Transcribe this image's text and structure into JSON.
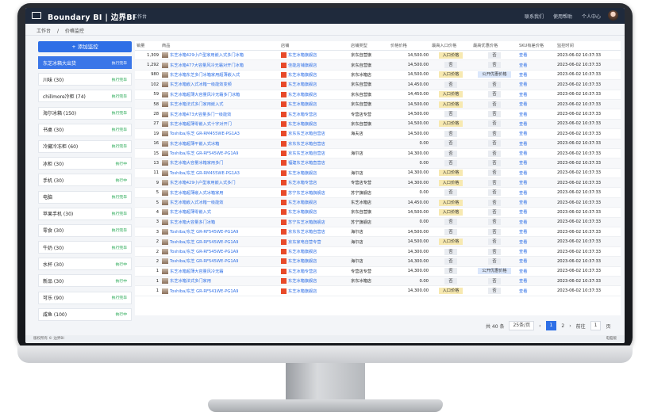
{
  "app": {
    "brand": "Boundary BI | 边界BI",
    "nav": "工作台",
    "right_items": [
      "联系我们",
      "使用帮助",
      "个人中心"
    ]
  },
  "breadcrumb": [
    "工作台",
    "价格监控"
  ],
  "sidebar": {
    "add_label": "+ 添加监控",
    "items": [
      {
        "label": "东芝冰箱大出货",
        "badge": "执行完毕",
        "active": true
      },
      {
        "label": "川味 (30)",
        "badge": "执行完毕"
      },
      {
        "label": "chillmore冷柜 (74)",
        "badge": "执行完毕"
      },
      {
        "label": "海尔冰箱 (150)",
        "badge": "执行完毕"
      },
      {
        "label": "书桌 (30)",
        "badge": "执行完毕"
      },
      {
        "label": "冷藏冷冻柜 (60)",
        "badge": "执行完毕"
      },
      {
        "label": "冰柜 (30)",
        "badge": "执行中"
      },
      {
        "label": "手机 (30)",
        "badge": "执行中"
      },
      {
        "label": "电脑",
        "badge": "执行完毕"
      },
      {
        "label": "苹果手机 (30)",
        "badge": "执行完毕"
      },
      {
        "label": "零食 (30)",
        "badge": "执行完毕"
      },
      {
        "label": "牛奶 (30)",
        "badge": "执行完毕"
      },
      {
        "label": "水杯 (30)",
        "badge": "执行中"
      },
      {
        "label": "新品 (30)",
        "badge": "执行中"
      },
      {
        "label": "可乐 (90)",
        "badge": "执行完毕"
      },
      {
        "label": "咸鱼 (100)",
        "badge": "执行中"
      }
    ]
  },
  "table": {
    "headers": [
      "销量",
      "商品",
      "店铺",
      "店铺类型",
      "价格价格",
      "最高入口价格",
      "最高优惠价格",
      "SKU有差价格",
      "监控时间"
    ],
    "rows": [
      [
        "1,309",
        "东芝冰箱429小户型家用嵌入式多门冰箱",
        "东芝冰箱旗舰店",
        "京东自营旗",
        "14,500.00",
        "入口价格",
        "否",
        "查看",
        "2023-06-02 10:37:33"
      ],
      [
        "1,292",
        "东芝冰箱477大容量风冷无霜对开门冰箱",
        "佳能店铺旗舰店",
        "京东自营旗",
        "14,500.00",
        "否",
        "否",
        "查看",
        "2023-06-02 10:37:33"
      ],
      [
        "980",
        "东芝冰箱东芝多门冰箱家用超薄嵌入式",
        "东芝冰箱旗舰店",
        "京东冰箱店",
        "14,500.00",
        "入口价格",
        "公开优惠价格",
        "查看",
        "2023-06-02 10:37:33"
      ],
      [
        "102",
        "东芝冰箱嵌入式冰箱一级能效变频",
        "东芝冰箱旗舰店",
        "京东自营旗",
        "14,450.00",
        "否",
        "否",
        "查看",
        "2023-06-02 10:37:33"
      ],
      [
        "59",
        "东芝冰箱超薄大容量风冷无霜多门冰箱",
        "东芝冰箱旗舰店",
        "京东自营旗",
        "14,450.00",
        "入口价格",
        "否",
        "查看",
        "2023-06-02 10:37:33"
      ],
      [
        "58",
        "东芝冰箱法式多门家用嵌入式",
        "东芝冰箱旗舰店",
        "京东自营旗",
        "14,500.00",
        "入口价格",
        "否",
        "查看",
        "2023-06-02 10:37:33"
      ],
      [
        "28",
        "东芝冰箱473大容量多门一级能效",
        "东芝冰箱专营店",
        "专营店专营",
        "14,500.00",
        "否",
        "否",
        "查看",
        "2023-06-02 10:37:33"
      ],
      [
        "27",
        "东芝冰箱超薄零嵌入式十字对开门",
        "东芝冰箱旗舰店",
        "京东自营旗",
        "14,500.00",
        "入口价格",
        "否",
        "查看",
        "2023-06-02 10:37:33"
      ],
      [
        "19",
        "Toshiba/东芝 GR-RM455WE-PG1A3",
        "京东东芝冰箱自营店",
        "海夫店",
        "14,500.00",
        "否",
        "否",
        "查看",
        "2023-06-02 10:37:33"
      ],
      [
        "16",
        "东芝冰箱超薄平嵌入式冰箱",
        "京东东芝冰箱自营店",
        "",
        "0.00",
        "否",
        "否",
        "查看",
        "2023-06-02 10:37:33"
      ],
      [
        "15",
        "Toshiba/东芝 GR-RF545WE-PG1A9",
        "京东东芝冰箱自营店",
        "海尔店",
        "14,300.00",
        "否",
        "否",
        "查看",
        "2023-06-02 10:37:33"
      ],
      [
        "13",
        "东芝冰箱大容量冰箱家用多门",
        "福建东芝冰箱直营店",
        "",
        "0.00",
        "否",
        "否",
        "查看",
        "2023-06-02 10:37:33"
      ],
      [
        "11",
        "Toshiba/东芝 GR-RM455WE-PG1A3",
        "东芝冰箱旗舰店",
        "海尔店",
        "14,300.00",
        "入口价格",
        "否",
        "查看",
        "2023-06-02 10:37:33"
      ],
      [
        "9",
        "东芝冰箱429小户型家用嵌入式多门",
        "东芝冰箱专营店",
        "专营店专营",
        "14,300.00",
        "入口价格",
        "否",
        "查看",
        "2023-06-02 10:37:33"
      ],
      [
        "5",
        "东芝冰箱超薄嵌入式冰箱家用",
        "苏宁东芝冰箱旗舰店",
        "苏宁旗舰店",
        "0.00",
        "否",
        "否",
        "查看",
        "2023-06-02 10:37:33"
      ],
      [
        "5",
        "东芝冰箱嵌入式冰箱一级能效",
        "东芝冰箱旗舰店",
        "东芝冰箱店",
        "14,450.00",
        "入口价格",
        "否",
        "查看",
        "2023-06-02 10:37:33"
      ],
      [
        "4",
        "东芝冰箱超薄零嵌入式",
        "东芝冰箱旗舰店",
        "京东自营旗",
        "14,500.00",
        "入口价格",
        "否",
        "查看",
        "2023-06-02 10:37:33"
      ],
      [
        "3",
        "东芝冰箱大容量多门冰箱",
        "苏宁东芝冰箱旗舰店",
        "苏宁旗舰店",
        "0.00",
        "否",
        "否",
        "查看",
        "2023-06-02 10:37:33"
      ],
      [
        "3",
        "Toshiba/东芝 GR-RF545WE-PG1A9",
        "京东东芝冰箱自营店",
        "海尔店",
        "14,500.00",
        "否",
        "否",
        "查看",
        "2023-06-02 10:37:33"
      ],
      [
        "2",
        "Toshiba/东芝 GR-RF545WE-PG1A9",
        "京东家电自营专营",
        "海尔店",
        "14,500.00",
        "入口价格",
        "否",
        "查看",
        "2023-06-02 10:37:33"
      ],
      [
        "2",
        "Toshiba/东芝 GR-RF545WE-PG1A9",
        "东芝冰箱旗舰店",
        "",
        "14,300.00",
        "否",
        "否",
        "查看",
        "2023-06-02 10:37:33"
      ],
      [
        "2",
        "Toshiba/东芝 GR-RF545WE-PG1A9",
        "东芝冰箱旗舰店",
        "海尔店",
        "14,300.00",
        "否",
        "否",
        "查看",
        "2023-06-02 10:37:33"
      ],
      [
        "1",
        "东芝冰箱超薄大容量风冷无霜",
        "东芝冰箱专营店",
        "专营店专营",
        "14,300.00",
        "否",
        "公开优惠价格",
        "查看",
        "2023-06-02 10:37:33"
      ],
      [
        "1",
        "东芝冰箱法式多门家用",
        "东芝冰箱旗舰店",
        "京东冰箱店",
        "0.00",
        "否",
        "否",
        "查看",
        "2023-06-02 10:37:33"
      ],
      [
        "1",
        "Toshiba/东芝 GR-RF541WE-PG1A9",
        "东芝冰箱旗舰店",
        "",
        "14,300.00",
        "入口价格",
        "否",
        "查看",
        "2023-06-02 10:37:33"
      ]
    ]
  },
  "pager": {
    "total": "共 40 条",
    "page_size": "25条/页",
    "pages": [
      "1",
      "2"
    ],
    "goto_label": "前往",
    "goto_value": "1",
    "page_unit": "页"
  },
  "status": {
    "left": "版权所有 © 边界BI",
    "right": "电脑版"
  }
}
